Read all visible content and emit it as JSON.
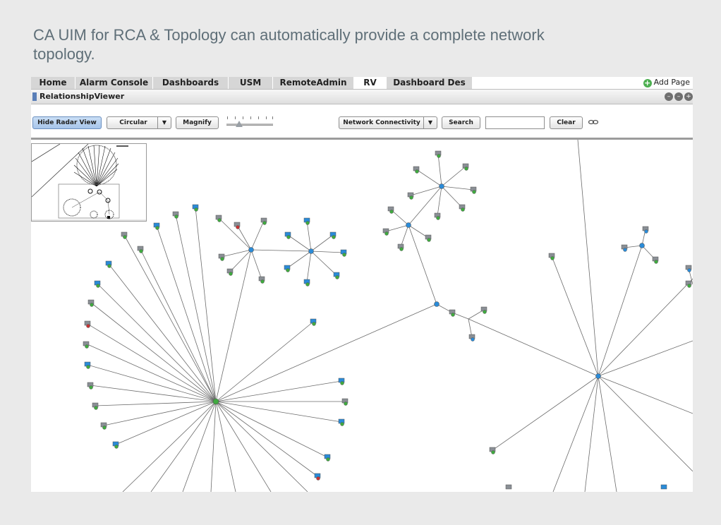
{
  "caption": "CA UIM for RCA & Topology can automatically provide a complete network topology.",
  "tabs": [
    {
      "label": "Home",
      "active": false
    },
    {
      "label": "Alarm Console",
      "active": false
    },
    {
      "label": "Dashboards",
      "active": false
    },
    {
      "label": "USM",
      "active": false
    },
    {
      "label": "RemoteAdmin",
      "active": false
    },
    {
      "label": "RV",
      "active": true
    },
    {
      "label": "Dashboard Des",
      "active": false
    }
  ],
  "add_page_label": "Add Page",
  "portlet": {
    "title": "RelationshipViewer"
  },
  "toolbar": {
    "hide_radar_label": "Hide Radar View",
    "layout_value": "Circular",
    "magnify_label": "Magnify",
    "connectivity_value": "Network Connectivity",
    "search_label": "Search",
    "search_value": "",
    "clear_label": "Clear"
  },
  "colors": {
    "node_green": "#3faa3f",
    "node_blue": "#2a8bd8",
    "node_red": "#c83232",
    "edge": "#6b6b6b",
    "accent_button": "#a7c5ea"
  },
  "icons": [
    "add-page-icon",
    "minimize-icon",
    "maximize-icon",
    "close-icon",
    "link-icon",
    "dropdown-arrow-icon"
  ]
}
